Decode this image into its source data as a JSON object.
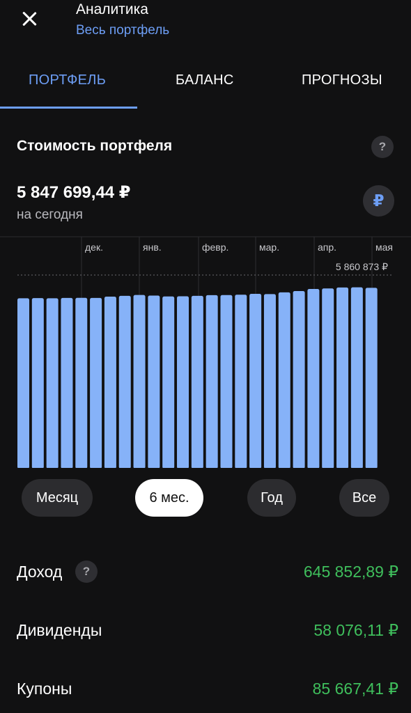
{
  "header": {
    "title": "Аналитика",
    "subtitle": "Весь портфель"
  },
  "tabs": [
    {
      "label": "ПОРТФЕЛЬ",
      "active": true
    },
    {
      "label": "БАЛАНС",
      "active": false
    },
    {
      "label": "ПРОГНОЗЫ",
      "active": false
    }
  ],
  "portfolio": {
    "section_title": "Стоимость портфеля",
    "help_glyph": "?",
    "value": "5 847 699,44 ₽",
    "caption": "на сегодня",
    "currency_glyph": "₽"
  },
  "chart_data": {
    "type": "bar",
    "x_tick_labels": [
      "дек.",
      "янв.",
      "февр.",
      "мар.",
      "апр.",
      "мая"
    ],
    "max_label": "5 860 873 ₽",
    "max_value": 5860873,
    "values": [
      5150000,
      5155000,
      5150000,
      5160000,
      5162000,
      5160000,
      5200000,
      5225000,
      5250000,
      5232000,
      5205000,
      5210000,
      5225000,
      5245000,
      5248000,
      5260000,
      5285000,
      5278000,
      5330000,
      5370000,
      5435000,
      5450000,
      5480000,
      5485000,
      5470000
    ],
    "ylim": [
      0,
      5860873
    ],
    "bar_color": "#86b2f8",
    "grid": true
  },
  "periods": [
    {
      "label": "Месяц",
      "selected": false
    },
    {
      "label": "6 мес.",
      "selected": true
    },
    {
      "label": "Год",
      "selected": false
    },
    {
      "label": "Все",
      "selected": false
    }
  ],
  "stats": [
    {
      "label": "Доход",
      "value": "645 852,89 ₽",
      "help": true
    },
    {
      "label": "Дивиденды",
      "value": "58 076,11 ₽",
      "help": false
    },
    {
      "label": "Купоны",
      "value": "85 667,41 ₽",
      "help": false
    }
  ],
  "colors": {
    "accent": "#6d9ef5",
    "positive": "#3fbf5c",
    "background": "#111112"
  }
}
